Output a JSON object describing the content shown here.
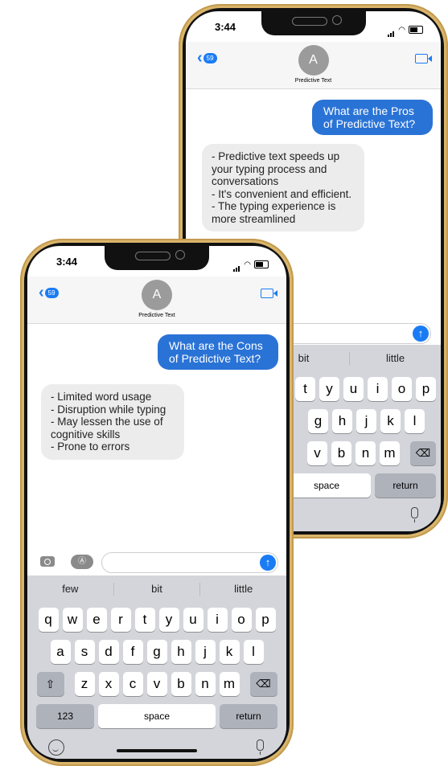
{
  "back_phone": {
    "status_time": "3:44",
    "back_count": "59",
    "avatar_initial": "A",
    "contact_name": "Predictive Text",
    "sent_message": "What are the Pros of Predictive Text?",
    "received_lines": [
      "- Predictive text speeds up your typing process and conversations",
      "- It's convenient and efficient.",
      "- The typing experience is more streamlined"
    ],
    "suggestions": [
      "bit",
      "little"
    ],
    "keyboard": {
      "row1": [
        "t",
        "y",
        "u",
        "i",
        "o",
        "p"
      ],
      "row2": [
        "g",
        "h",
        "j",
        "k",
        "l"
      ],
      "row3": [
        "v",
        "b",
        "n",
        "m"
      ],
      "space": "space",
      "return": "return"
    }
  },
  "front_phone": {
    "status_time": "3:44",
    "back_count": "59",
    "avatar_initial": "A",
    "contact_name": "Predictive Text",
    "sent_message": "What are the Cons of Predictive Text?",
    "received_lines": [
      "- Limited word usage",
      "- Disruption while typing",
      "- May lessen the use of cognitive skills",
      "- Prone to errors"
    ],
    "suggestions": [
      "few",
      "bit",
      "little"
    ],
    "keyboard": {
      "row1": [
        "q",
        "w",
        "e",
        "r",
        "t",
        "y",
        "u",
        "i",
        "o",
        "p"
      ],
      "row2": [
        "a",
        "s",
        "d",
        "f",
        "g",
        "h",
        "j",
        "k",
        "l"
      ],
      "row3": [
        "z",
        "x",
        "c",
        "v",
        "b",
        "n",
        "m"
      ],
      "numbers": "123",
      "space": "space",
      "return": "return"
    }
  },
  "colors": {
    "phone_frame": "#d9b46b",
    "sent_bubble": "#2a73d6",
    "accent": "#1a7cf5",
    "received_bubble": "#ececec",
    "keyboard_bg": "#d3d5da"
  },
  "icons": [
    "back-chevron-icon",
    "video-camera-icon",
    "camera-icon",
    "app-store-icon",
    "send-arrow-icon",
    "shift-icon",
    "backspace-icon",
    "emoji-icon",
    "microphone-icon",
    "wifi-icon",
    "battery-icon",
    "signal-icon"
  ]
}
